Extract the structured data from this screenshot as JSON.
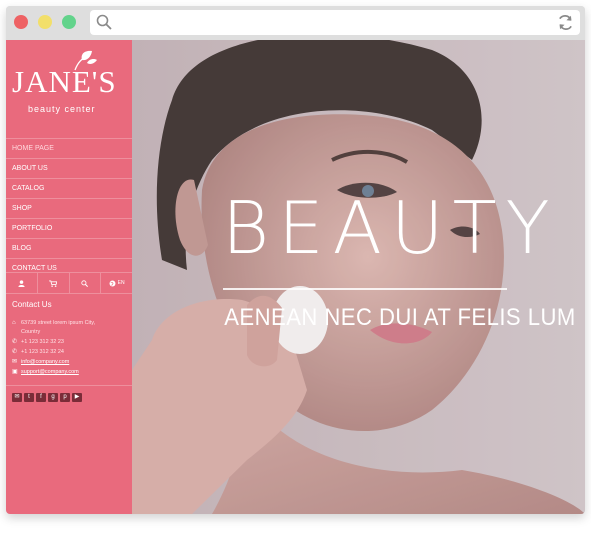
{
  "browser": {
    "search_icon": "search-icon",
    "reload_icon": "reload-icon"
  },
  "brand": {
    "name": "JANE'S",
    "tagline": "beauty center"
  },
  "nav": {
    "items": [
      {
        "label": "HOME PAGE"
      },
      {
        "label": "ABOUT US"
      },
      {
        "label": "CATALOG"
      },
      {
        "label": "SHOP"
      },
      {
        "label": "PORTFOLIO"
      },
      {
        "label": "BLOG"
      },
      {
        "label": "CONTACT US"
      }
    ]
  },
  "iconbar": {
    "language": "EN"
  },
  "contact": {
    "title": "Contact Us",
    "address_line1": "63739 street lorem ipsum City,",
    "address_line2": "Country",
    "phone1": "+1 123 312 32 23",
    "phone2": "+1 123 312 32 24",
    "email1": "info@company.com",
    "email2": "support@company.com"
  },
  "social": [
    "email",
    "twitter",
    "facebook",
    "google-plus",
    "pinterest",
    "youtube"
  ],
  "hero": {
    "title": "BEAUTY",
    "subtitle": "AENEAN NEC DUI AT FELIS LUM"
  },
  "colors": {
    "sidebar": "#e96a7d",
    "accent": "#ffffff"
  }
}
